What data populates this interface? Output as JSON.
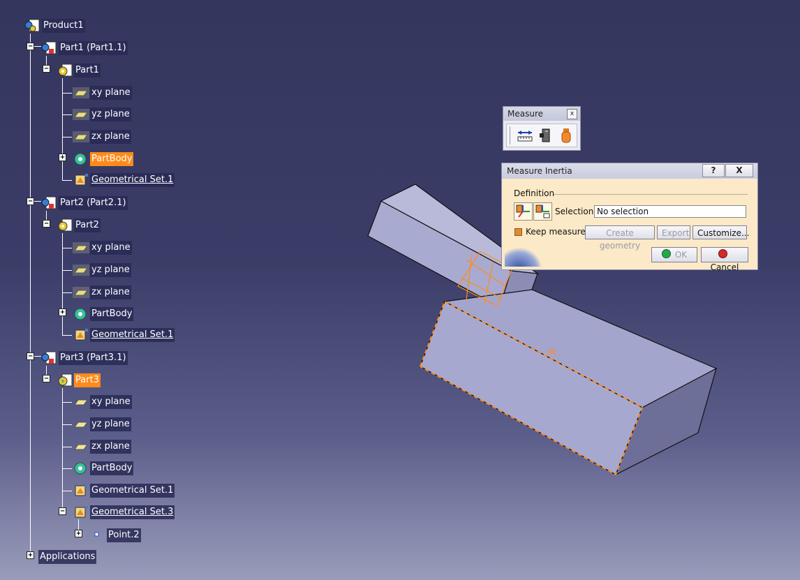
{
  "tree": {
    "root": "Product1",
    "parts": [
      {
        "instance": "Part1 (Part1.1)",
        "part": "Part1",
        "items": [
          "xy plane",
          "yz plane",
          "zx plane",
          "PartBody",
          "Geometrical Set.1"
        ]
      },
      {
        "instance": "Part2 (Part2.1)",
        "part": "Part2",
        "items": [
          "xy plane",
          "yz plane",
          "zx plane",
          "PartBody",
          "Geometrical Set.1"
        ]
      },
      {
        "instance": "Part3 (Part3.1)",
        "part": "Part3",
        "items": [
          "xy plane",
          "yz plane",
          "zx plane",
          "PartBody",
          "Geometrical Set.1",
          "Geometrical Set.3"
        ],
        "sub_items": [
          "Point.2"
        ]
      }
    ],
    "applications": "Applications"
  },
  "measure_toolbar": {
    "title": "Measure",
    "close": "x",
    "tools": [
      "measure-between-icon",
      "measure-item-icon",
      "measure-inertia-icon"
    ]
  },
  "dialog": {
    "title": "Measure Inertia",
    "help": "?",
    "close": "X",
    "group": "Definition",
    "selection_label": "Selection :",
    "selection_value": "No selection",
    "keep_measure": "Keep measure",
    "create_geometry": "Create geometry",
    "export": "Export",
    "customize": "Customize...",
    "ok": "OK",
    "cancel": "Cancel"
  },
  "colors": {
    "highlight": "#ff8a1a",
    "solid_face": "#a7a8cf",
    "background_top": "#34365e",
    "background_bottom": "#9a9cbb"
  }
}
